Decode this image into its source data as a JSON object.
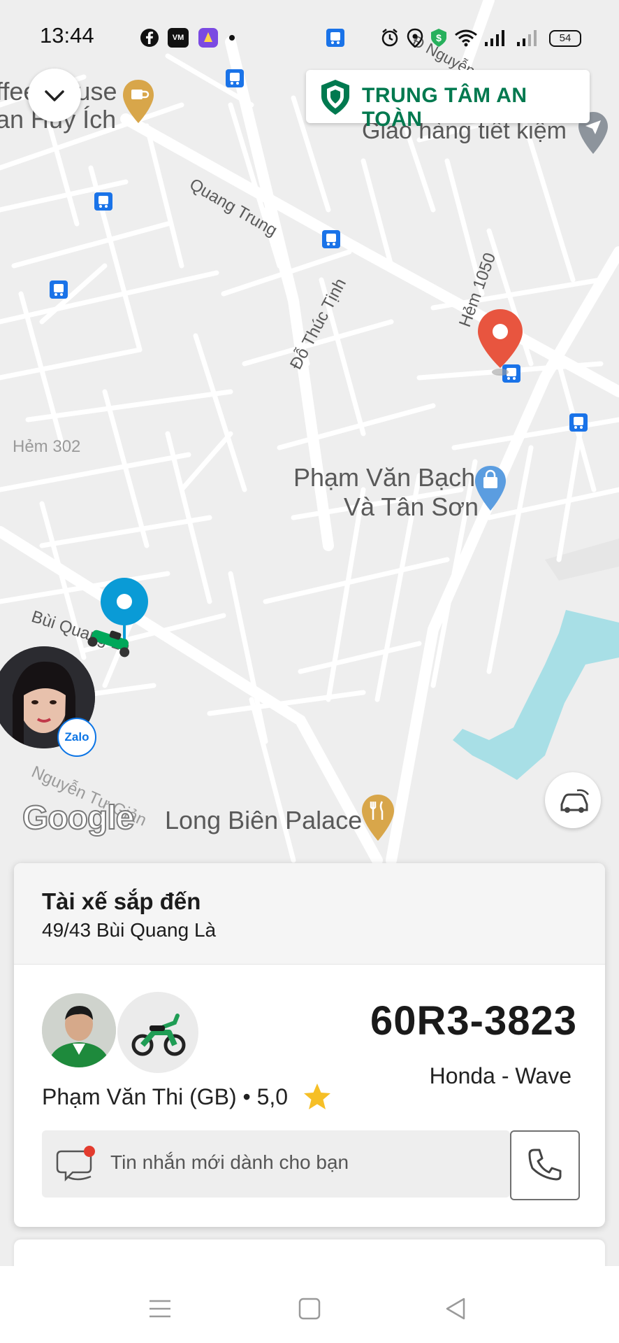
{
  "status_bar": {
    "time": "13:44",
    "battery": "54"
  },
  "safety_center": {
    "label": "TRUNG TÂM AN TOÀN"
  },
  "map": {
    "labels": {
      "coffee_house": "ffee House",
      "huy_ich": "an Huy Ích",
      "giao_hang": "Giao hàng tiết kiệm",
      "quang_trung": "Quang Trung",
      "do_thuc_tinh": "Đỗ Thúc Tịnh",
      "hem_1050": "Hẻm 1050",
      "hem_302": "Hẻm 302",
      "pham_van_bach": "Phạm Văn Bạch",
      "va_tan_son": "Và Tân Sơn",
      "bui_quang_la": "Bùi Quang Là",
      "nguyen_tu_gian": "Nguyễn Tư Giản",
      "long_bien_palace": "Long Biên Palace",
      "nguyen_top": "Đ Nguyễn"
    },
    "attribution": "Google"
  },
  "chat_head": {
    "badge": "Zalo"
  },
  "trip_card": {
    "title": "Tài xế sắp đến",
    "pickup_address": "49/43 Bùi Quang Là",
    "plate_number": "60R3-3823",
    "vehicle_model": "Honda - Wave",
    "driver_name": "Phạm Văn Thi (GB) • 5,0",
    "message_placeholder": "Tin nhắn mới dành cho bạn"
  },
  "colors": {
    "brand_green": "#00794f",
    "pin_red": "#e8553f",
    "driver_blue": "#0a9bd6",
    "water": "#a8dfe6",
    "bus_stop": "#1a73e8",
    "poi_gold": "#d8a64a"
  }
}
